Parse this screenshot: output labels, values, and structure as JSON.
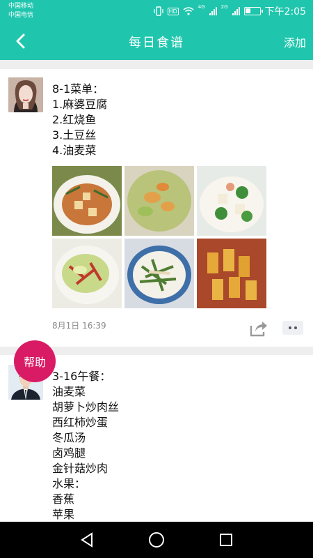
{
  "status": {
    "carrier1": "中国移动",
    "carrier2": "中国电信",
    "hd": "HD",
    "net1": "4G",
    "net2": "2G",
    "time": "下午2:05"
  },
  "appbar": {
    "title": "每日食谱",
    "add_label": "添加",
    "back_icon": "chevron-left-icon"
  },
  "posts": [
    {
      "text": "8-1菜单：\n1.麻婆豆腐\n2.红烧鱼\n3.土豆丝\n4.油麦菜",
      "time": "8月1日 16:39",
      "photo_count": 6
    },
    {
      "text": "3-16午餐：\n油麦菜\n胡萝卜炒肉丝\n西红柿炒蛋\n冬瓜汤\n卤鸡腿\n金针菇炒肉\n水果：\n香蕉\n苹果"
    }
  ],
  "help_label": "帮助",
  "colors": {
    "accent": "#1fc6ad",
    "help": "#d81b64"
  }
}
